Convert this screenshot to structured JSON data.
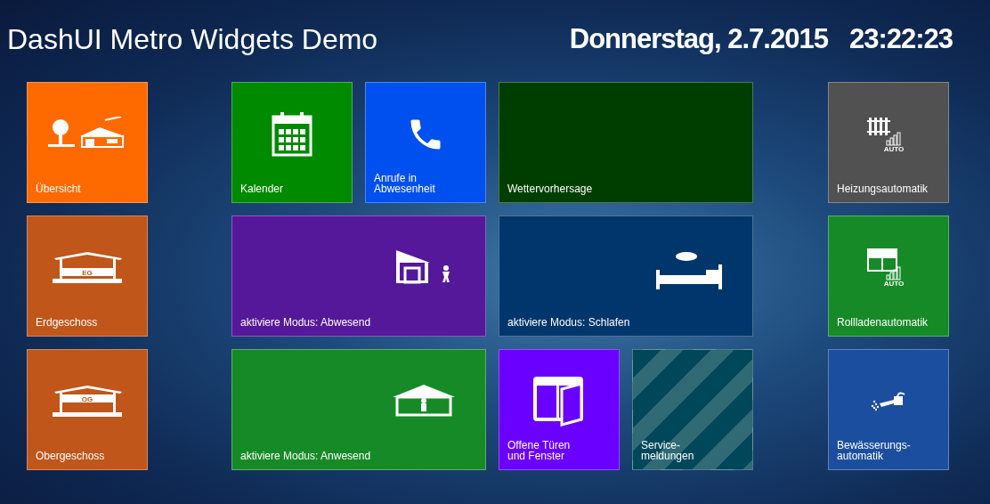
{
  "title": "DashUI Metro Widgets Demo",
  "date": "Donnerstag, 2.7.2015",
  "time": "23:22:23",
  "left_tiles": [
    {
      "label": "Übersicht",
      "color": "#ff6a00",
      "kind": "overview"
    },
    {
      "label": "Erdgeschoss",
      "color": "#c0561a",
      "kind": "floor",
      "badge": "EG"
    },
    {
      "label": "Obergeschoss",
      "color": "#c0561a",
      "kind": "floor",
      "badge": "OG"
    }
  ],
  "center_tiles": [
    {
      "label": "Kalender",
      "color": "#008a00",
      "kind": "calendar"
    },
    {
      "label": "Anrufe in\nAbwesenheit",
      "color": "#0050ef",
      "kind": "phone"
    },
    {
      "label": "Wettervorhersage",
      "color": "#003e00",
      "kind": "weather"
    },
    {
      "label": "aktiviere Modus: Abwesend",
      "color": "#55189b",
      "kind": "away"
    },
    {
      "label": "aktiviere Modus: Schlafen",
      "color": "#00366b",
      "kind": "sleep"
    },
    {
      "label": "aktiviere Modus: Anwesend",
      "color": "#178a28",
      "kind": "home"
    },
    {
      "label": "Offene Türen\nund Fenster",
      "color": "#6a00ff",
      "kind": "door"
    },
    {
      "label": "Service-\nmeldungen",
      "color": "#00475a",
      "kind": "service",
      "striped": true
    }
  ],
  "right_tiles": [
    {
      "label": "Heizungsautomatik",
      "color": "#515151",
      "kind": "heating",
      "badge": "AUTO"
    },
    {
      "label": "Rollladenautomatik",
      "color": "#178a28",
      "kind": "shutter",
      "badge": "AUTO"
    },
    {
      "label": "Bewässerungs-\nautomatik",
      "color": "#1c4ea0",
      "kind": "watering"
    }
  ]
}
